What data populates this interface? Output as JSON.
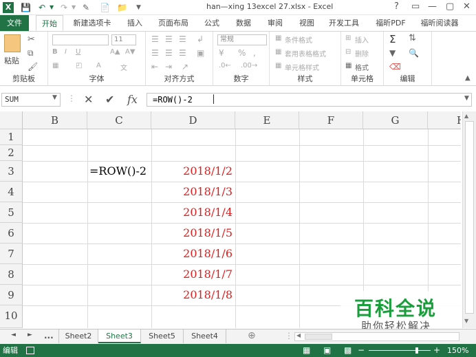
{
  "window": {
    "title": "han—xing 13excel 27.xlsx - Excel",
    "app_icon": "X",
    "controls": [
      "?",
      "▭",
      "—",
      "▢",
      "✕"
    ]
  },
  "ribbon_tabs": [
    {
      "label": "文件"
    },
    {
      "label": "开始"
    },
    {
      "label": "新建选项卡"
    },
    {
      "label": "插入"
    },
    {
      "label": "页面布局"
    },
    {
      "label": "公式"
    },
    {
      "label": "数据"
    },
    {
      "label": "审阅"
    },
    {
      "label": "视图"
    },
    {
      "label": "开发工具"
    },
    {
      "label": "福昕PDF"
    },
    {
      "label": "福昕阅读器"
    }
  ],
  "ribbon": {
    "clipboard": {
      "label": "剪贴板",
      "paste": "粘贴"
    },
    "font": {
      "label": "字体",
      "size": "11",
      "bold": "B",
      "italic": "I",
      "underline": "U"
    },
    "align": {
      "label": "对齐方式"
    },
    "number": {
      "label": "数字",
      "format": "常规",
      "percent": "%",
      "comma": ","
    },
    "styles": {
      "label": "样式",
      "cond": "条件格式",
      "table": "套用表格格式",
      "cell": "单元格样式"
    },
    "cells": {
      "label": "单元格",
      "insert": "插入",
      "delete": "删除",
      "format": "格式"
    },
    "edit": {
      "label": "编辑"
    }
  },
  "formula_bar": {
    "name_box": "SUM",
    "cancel": "✕",
    "enter": "✔",
    "fx": "fx",
    "formula": "=ROW()-2"
  },
  "columns": [
    "B",
    "C",
    "D",
    "E",
    "F",
    "G",
    "H"
  ],
  "rows": [
    "1",
    "2",
    "3",
    "4",
    "5",
    "6",
    "7",
    "8",
    "9",
    "10"
  ],
  "cells": {
    "C3": "=ROW()-2",
    "D3": "2018/1/2",
    "D4": "2018/1/3",
    "D5": "2018/1/4",
    "D6": "2018/1/5",
    "D7": "2018/1/6",
    "D8": "2018/1/7",
    "D9": "2018/1/8"
  },
  "sheets": {
    "nav_prev": "◄",
    "nav_next": "►",
    "more": "...",
    "tabs": [
      "Sheet2",
      "Sheet3",
      "Sheet5",
      "Sheet4"
    ],
    "active": "Sheet3",
    "add": "⊕"
  },
  "status": {
    "mode": "编辑",
    "zoom": "150%"
  },
  "watermark": {
    "line1": "百科全说",
    "line2": "助你轻松解决"
  },
  "colors": {
    "excel_green": "#217346",
    "date_red": "#e31b1b"
  }
}
